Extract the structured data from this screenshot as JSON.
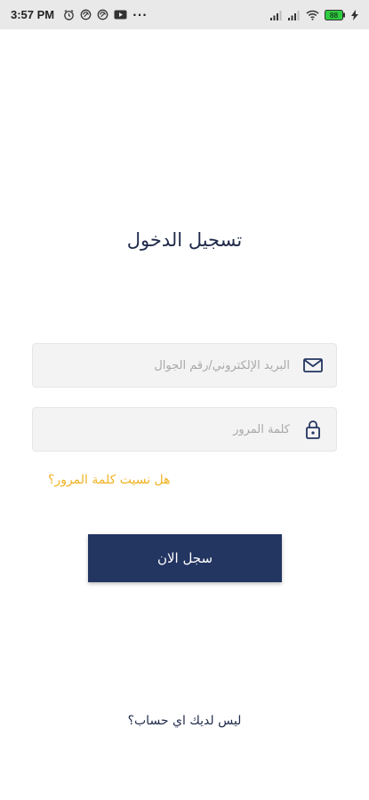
{
  "status_bar": {
    "time": "3:57 PM",
    "more": "···",
    "battery": "88"
  },
  "login": {
    "title": "تسجيل الدخول",
    "email_placeholder": "البريد الإلكتروني/رقم الجوال",
    "password_placeholder": "كلمة المرور",
    "forgot_password": "هل نسيت كلمة المرور؟",
    "submit_label": "سجل الان",
    "no_account": "ليس لديك اي حساب؟"
  },
  "colors": {
    "primary": "#233561",
    "accent": "#f0b323",
    "field_background": "#f3f3f3",
    "title_text": "#1f2a4a"
  },
  "icons": {
    "email": "envelope-icon",
    "password": "lock-icon"
  }
}
